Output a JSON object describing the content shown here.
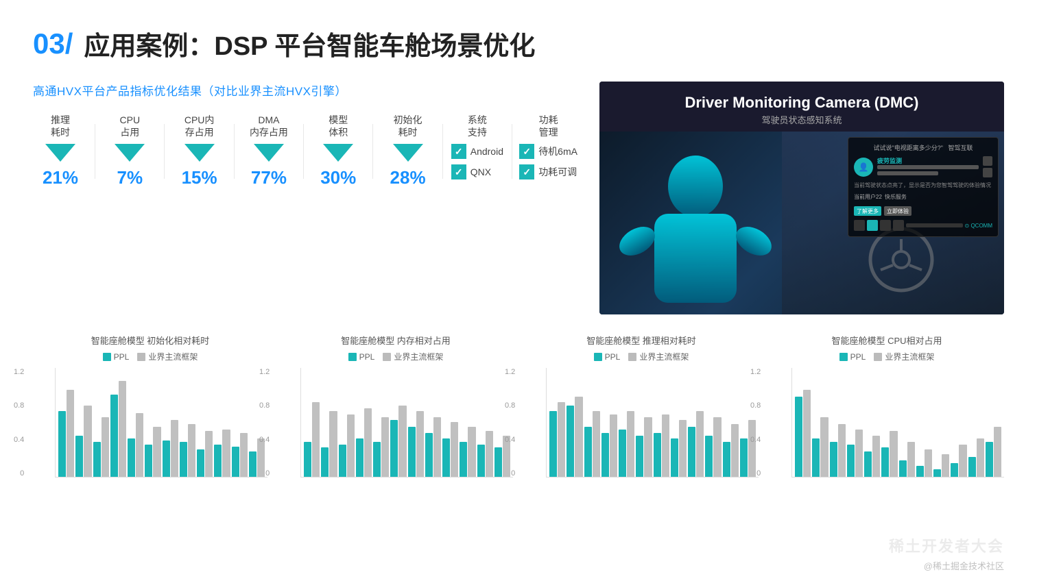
{
  "slide": {
    "title_number": "03/",
    "title_text": "应用案例：DSP 平台智能车舱场景优化"
  },
  "metrics_section": {
    "title": "高通HVX平台产品指标优化结果（对比业界主流HVX引擎）",
    "metrics": [
      {
        "label": "推理\n耗时",
        "value": "21%",
        "has_arrow": true
      },
      {
        "label": "CPU\n占用",
        "value": "7%",
        "has_arrow": true
      },
      {
        "label": "CPU内\n存占用",
        "value": "15%",
        "has_arrow": true
      },
      {
        "label": "DMA\n内存占用",
        "value": "77%",
        "has_arrow": true
      },
      {
        "label": "模型\n体积",
        "value": "30%",
        "has_arrow": true
      },
      {
        "label": "初始化\n耗时",
        "value": "28%",
        "has_arrow": true
      }
    ],
    "system_support": {
      "label": "系统\n支持",
      "items": [
        "Android",
        "QNX"
      ]
    },
    "power_management": {
      "label": "功耗\n管理",
      "items": [
        "待机6mA",
        "功耗可调"
      ]
    }
  },
  "dmc": {
    "title_en": "Driver Monitoring Camera (DMC)",
    "title_cn": "驾驶员状态感知系统"
  },
  "charts": [
    {
      "title": "智能座舱模型 初始化相对耗时",
      "legend_ppl": "PPL",
      "legend_industry": "业界主流框架",
      "y_labels": [
        "1.2",
        "0.8",
        "0.4",
        "0"
      ],
      "bars": [
        [
          0.72,
          0.95
        ],
        [
          0.45,
          0.78
        ],
        [
          0.38,
          0.65
        ],
        [
          0.9,
          1.05
        ],
        [
          0.42,
          0.7
        ],
        [
          0.35,
          0.55
        ],
        [
          0.4,
          0.62
        ],
        [
          0.38,
          0.58
        ],
        [
          0.3,
          0.5
        ],
        [
          0.35,
          0.52
        ],
        [
          0.33,
          0.48
        ],
        [
          0.28,
          0.42
        ]
      ]
    },
    {
      "title": "智能座舱模型 内存相对占用",
      "legend_ppl": "PPL",
      "legend_industry": "业界主流框架",
      "y_labels": [
        "1.2",
        "0.8",
        "0.4",
        "0"
      ],
      "bars": [
        [
          0.38,
          0.82
        ],
        [
          0.32,
          0.72
        ],
        [
          0.35,
          0.68
        ],
        [
          0.42,
          0.75
        ],
        [
          0.38,
          0.65
        ],
        [
          0.62,
          0.78
        ],
        [
          0.55,
          0.72
        ],
        [
          0.48,
          0.65
        ],
        [
          0.42,
          0.6
        ],
        [
          0.38,
          0.55
        ],
        [
          0.35,
          0.5
        ],
        [
          0.32,
          0.45
        ]
      ]
    },
    {
      "title": "智能座舱模型 推理相对耗时",
      "legend_ppl": "PPL",
      "legend_industry": "业界主流框架",
      "y_labels": [
        "1.2",
        "0.8",
        "0.4",
        "0"
      ],
      "bars": [
        [
          0.72,
          0.82
        ],
        [
          0.78,
          0.88
        ],
        [
          0.55,
          0.72
        ],
        [
          0.48,
          0.68
        ],
        [
          0.52,
          0.72
        ],
        [
          0.45,
          0.65
        ],
        [
          0.48,
          0.68
        ],
        [
          0.42,
          0.62
        ],
        [
          0.55,
          0.72
        ],
        [
          0.45,
          0.65
        ],
        [
          0.38,
          0.58
        ],
        [
          0.42,
          0.62
        ]
      ]
    },
    {
      "title": "智能座舱模型 CPU相对占用",
      "legend_ppl": "PPL",
      "legend_industry": "业界主流框架",
      "y_labels": [
        "1.2",
        "0.8",
        "0.4",
        "0"
      ],
      "bars": [
        [
          0.88,
          0.95
        ],
        [
          0.42,
          0.65
        ],
        [
          0.38,
          0.58
        ],
        [
          0.35,
          0.52
        ],
        [
          0.28,
          0.45
        ],
        [
          0.32,
          0.5
        ],
        [
          0.18,
          0.38
        ],
        [
          0.12,
          0.3
        ],
        [
          0.08,
          0.25
        ],
        [
          0.15,
          0.35
        ],
        [
          0.22,
          0.42
        ],
        [
          0.38,
          0.55
        ]
      ]
    }
  ],
  "watermark": {
    "main": "稀土开发者大会",
    "sub": "@稀土掘金技术社区"
  }
}
